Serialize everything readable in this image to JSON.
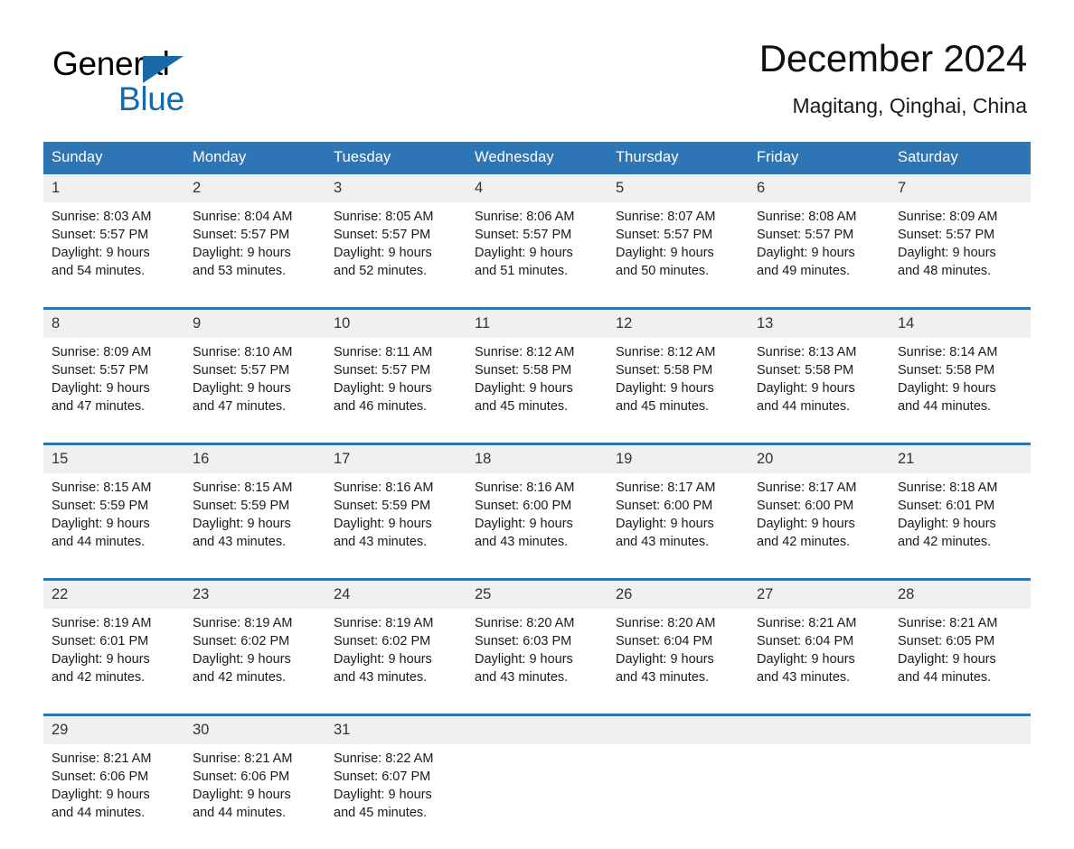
{
  "brand": {
    "name_top": "General",
    "name_bottom": "Blue",
    "accent_color": "#1769a8"
  },
  "header": {
    "title": "December 2024",
    "subtitle": "Magitang, Qinghai, China"
  },
  "theme": {
    "header_blue": "#2e75b6",
    "date_band": "#f0f0f0",
    "rule_blue": "#2e75b6"
  },
  "calendar": {
    "weekday_headers": [
      "Sunday",
      "Monday",
      "Tuesday",
      "Wednesday",
      "Thursday",
      "Friday",
      "Saturday"
    ],
    "weeks": [
      {
        "days": [
          {
            "date": "1",
            "sunrise": "Sunrise: 8:03 AM",
            "sunset": "Sunset: 5:57 PM",
            "daylight_line1": "Daylight: 9 hours",
            "daylight_line2": "and 54 minutes."
          },
          {
            "date": "2",
            "sunrise": "Sunrise: 8:04 AM",
            "sunset": "Sunset: 5:57 PM",
            "daylight_line1": "Daylight: 9 hours",
            "daylight_line2": "and 53 minutes."
          },
          {
            "date": "3",
            "sunrise": "Sunrise: 8:05 AM",
            "sunset": "Sunset: 5:57 PM",
            "daylight_line1": "Daylight: 9 hours",
            "daylight_line2": "and 52 minutes."
          },
          {
            "date": "4",
            "sunrise": "Sunrise: 8:06 AM",
            "sunset": "Sunset: 5:57 PM",
            "daylight_line1": "Daylight: 9 hours",
            "daylight_line2": "and 51 minutes."
          },
          {
            "date": "5",
            "sunrise": "Sunrise: 8:07 AM",
            "sunset": "Sunset: 5:57 PM",
            "daylight_line1": "Daylight: 9 hours",
            "daylight_line2": "and 50 minutes."
          },
          {
            "date": "6",
            "sunrise": "Sunrise: 8:08 AM",
            "sunset": "Sunset: 5:57 PM",
            "daylight_line1": "Daylight: 9 hours",
            "daylight_line2": "and 49 minutes."
          },
          {
            "date": "7",
            "sunrise": "Sunrise: 8:09 AM",
            "sunset": "Sunset: 5:57 PM",
            "daylight_line1": "Daylight: 9 hours",
            "daylight_line2": "and 48 minutes."
          }
        ]
      },
      {
        "days": [
          {
            "date": "8",
            "sunrise": "Sunrise: 8:09 AM",
            "sunset": "Sunset: 5:57 PM",
            "daylight_line1": "Daylight: 9 hours",
            "daylight_line2": "and 47 minutes."
          },
          {
            "date": "9",
            "sunrise": "Sunrise: 8:10 AM",
            "sunset": "Sunset: 5:57 PM",
            "daylight_line1": "Daylight: 9 hours",
            "daylight_line2": "and 47 minutes."
          },
          {
            "date": "10",
            "sunrise": "Sunrise: 8:11 AM",
            "sunset": "Sunset: 5:57 PM",
            "daylight_line1": "Daylight: 9 hours",
            "daylight_line2": "and 46 minutes."
          },
          {
            "date": "11",
            "sunrise": "Sunrise: 8:12 AM",
            "sunset": "Sunset: 5:58 PM",
            "daylight_line1": "Daylight: 9 hours",
            "daylight_line2": "and 45 minutes."
          },
          {
            "date": "12",
            "sunrise": "Sunrise: 8:12 AM",
            "sunset": "Sunset: 5:58 PM",
            "daylight_line1": "Daylight: 9 hours",
            "daylight_line2": "and 45 minutes."
          },
          {
            "date": "13",
            "sunrise": "Sunrise: 8:13 AM",
            "sunset": "Sunset: 5:58 PM",
            "daylight_line1": "Daylight: 9 hours",
            "daylight_line2": "and 44 minutes."
          },
          {
            "date": "14",
            "sunrise": "Sunrise: 8:14 AM",
            "sunset": "Sunset: 5:58 PM",
            "daylight_line1": "Daylight: 9 hours",
            "daylight_line2": "and 44 minutes."
          }
        ]
      },
      {
        "days": [
          {
            "date": "15",
            "sunrise": "Sunrise: 8:15 AM",
            "sunset": "Sunset: 5:59 PM",
            "daylight_line1": "Daylight: 9 hours",
            "daylight_line2": "and 44 minutes."
          },
          {
            "date": "16",
            "sunrise": "Sunrise: 8:15 AM",
            "sunset": "Sunset: 5:59 PM",
            "daylight_line1": "Daylight: 9 hours",
            "daylight_line2": "and 43 minutes."
          },
          {
            "date": "17",
            "sunrise": "Sunrise: 8:16 AM",
            "sunset": "Sunset: 5:59 PM",
            "daylight_line1": "Daylight: 9 hours",
            "daylight_line2": "and 43 minutes."
          },
          {
            "date": "18",
            "sunrise": "Sunrise: 8:16 AM",
            "sunset": "Sunset: 6:00 PM",
            "daylight_line1": "Daylight: 9 hours",
            "daylight_line2": "and 43 minutes."
          },
          {
            "date": "19",
            "sunrise": "Sunrise: 8:17 AM",
            "sunset": "Sunset: 6:00 PM",
            "daylight_line1": "Daylight: 9 hours",
            "daylight_line2": "and 43 minutes."
          },
          {
            "date": "20",
            "sunrise": "Sunrise: 8:17 AM",
            "sunset": "Sunset: 6:00 PM",
            "daylight_line1": "Daylight: 9 hours",
            "daylight_line2": "and 42 minutes."
          },
          {
            "date": "21",
            "sunrise": "Sunrise: 8:18 AM",
            "sunset": "Sunset: 6:01 PM",
            "daylight_line1": "Daylight: 9 hours",
            "daylight_line2": "and 42 minutes."
          }
        ]
      },
      {
        "days": [
          {
            "date": "22",
            "sunrise": "Sunrise: 8:19 AM",
            "sunset": "Sunset: 6:01 PM",
            "daylight_line1": "Daylight: 9 hours",
            "daylight_line2": "and 42 minutes."
          },
          {
            "date": "23",
            "sunrise": "Sunrise: 8:19 AM",
            "sunset": "Sunset: 6:02 PM",
            "daylight_line1": "Daylight: 9 hours",
            "daylight_line2": "and 42 minutes."
          },
          {
            "date": "24",
            "sunrise": "Sunrise: 8:19 AM",
            "sunset": "Sunset: 6:02 PM",
            "daylight_line1": "Daylight: 9 hours",
            "daylight_line2": "and 43 minutes."
          },
          {
            "date": "25",
            "sunrise": "Sunrise: 8:20 AM",
            "sunset": "Sunset: 6:03 PM",
            "daylight_line1": "Daylight: 9 hours",
            "daylight_line2": "and 43 minutes."
          },
          {
            "date": "26",
            "sunrise": "Sunrise: 8:20 AM",
            "sunset": "Sunset: 6:04 PM",
            "daylight_line1": "Daylight: 9 hours",
            "daylight_line2": "and 43 minutes."
          },
          {
            "date": "27",
            "sunrise": "Sunrise: 8:21 AM",
            "sunset": "Sunset: 6:04 PM",
            "daylight_line1": "Daylight: 9 hours",
            "daylight_line2": "and 43 minutes."
          },
          {
            "date": "28",
            "sunrise": "Sunrise: 8:21 AM",
            "sunset": "Sunset: 6:05 PM",
            "daylight_line1": "Daylight: 9 hours",
            "daylight_line2": "and 44 minutes."
          }
        ]
      },
      {
        "days": [
          {
            "date": "29",
            "sunrise": "Sunrise: 8:21 AM",
            "sunset": "Sunset: 6:06 PM",
            "daylight_line1": "Daylight: 9 hours",
            "daylight_line2": "and 44 minutes."
          },
          {
            "date": "30",
            "sunrise": "Sunrise: 8:21 AM",
            "sunset": "Sunset: 6:06 PM",
            "daylight_line1": "Daylight: 9 hours",
            "daylight_line2": "and 44 minutes."
          },
          {
            "date": "31",
            "sunrise": "Sunrise: 8:22 AM",
            "sunset": "Sunset: 6:07 PM",
            "daylight_line1": "Daylight: 9 hours",
            "daylight_line2": "and 45 minutes."
          },
          {
            "date": "",
            "sunrise": "",
            "sunset": "",
            "daylight_line1": "",
            "daylight_line2": ""
          },
          {
            "date": "",
            "sunrise": "",
            "sunset": "",
            "daylight_line1": "",
            "daylight_line2": ""
          },
          {
            "date": "",
            "sunrise": "",
            "sunset": "",
            "daylight_line1": "",
            "daylight_line2": ""
          },
          {
            "date": "",
            "sunrise": "",
            "sunset": "",
            "daylight_line1": "",
            "daylight_line2": ""
          }
        ]
      }
    ]
  }
}
